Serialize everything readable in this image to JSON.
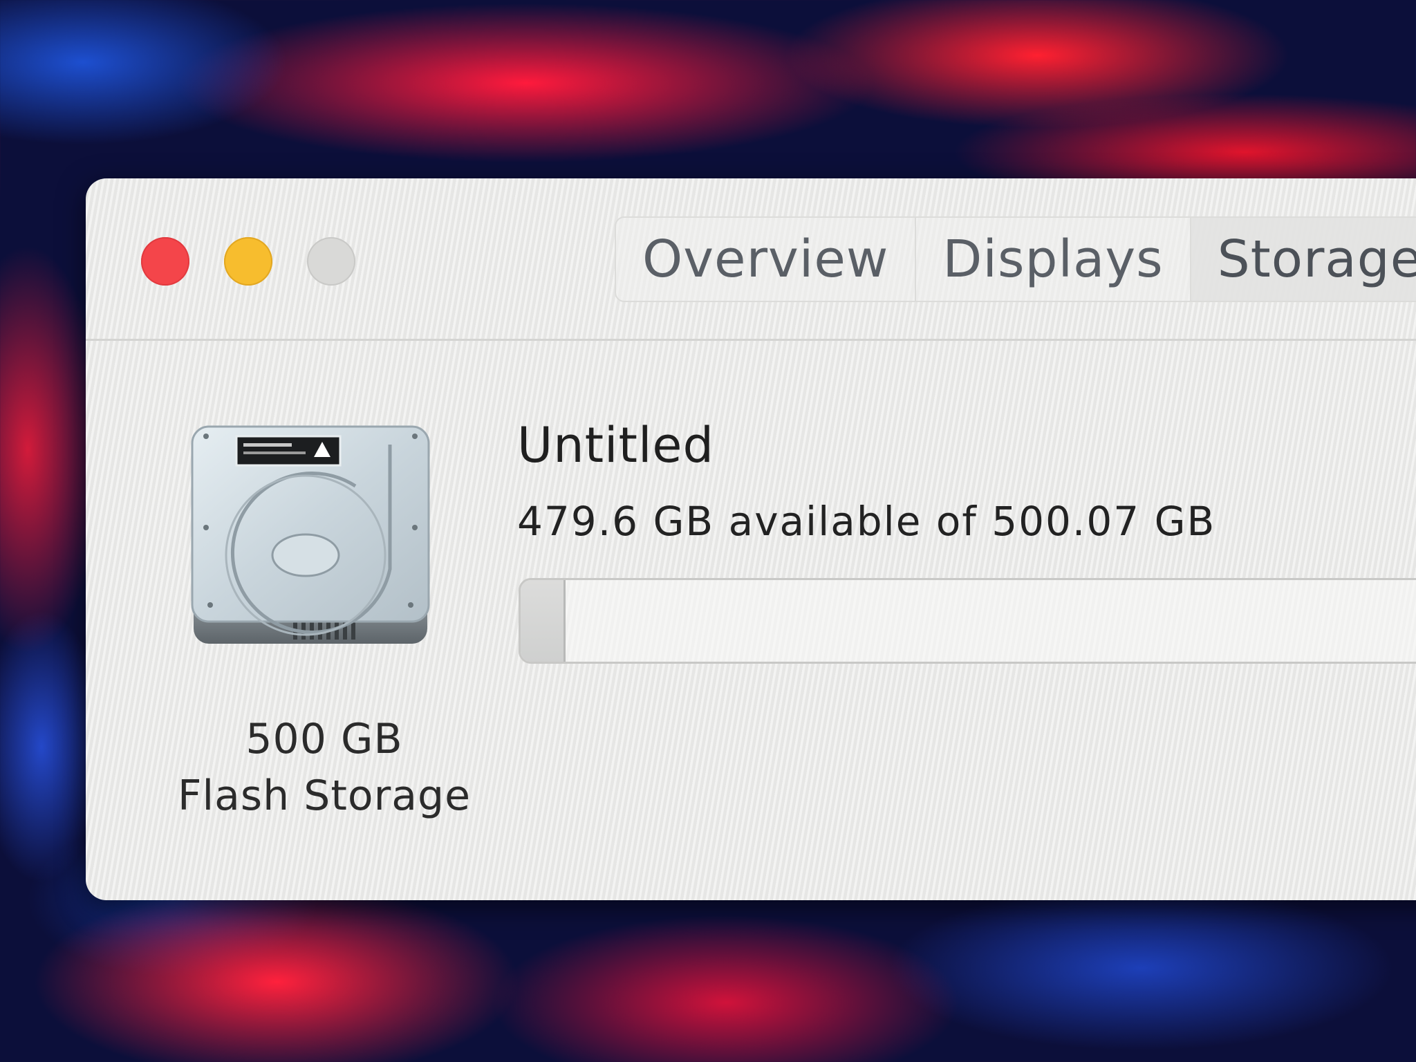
{
  "window": {
    "tabs": [
      {
        "label": "Overview",
        "selected": false
      },
      {
        "label": "Displays",
        "selected": false
      },
      {
        "label": "Storage",
        "selected": true
      }
    ]
  },
  "drive": {
    "icon": "hard-drive-icon",
    "capacity_label": "500 GB",
    "type_label": "Flash Storage"
  },
  "volume": {
    "name": "Untitled",
    "availability": "479.6 GB available of 500.07 GB",
    "used_fraction": 0.041
  },
  "colors": {
    "close": "#f4454a",
    "minimize": "#f7bd2e",
    "zoom": "#d9d9d7"
  }
}
